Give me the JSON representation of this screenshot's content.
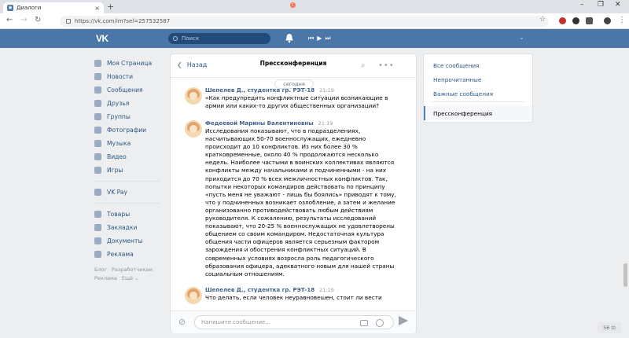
{
  "browser": {
    "tab_title": "Диалоги",
    "tab_favicon": "vk",
    "new_tab": "+",
    "url": "https://vk.com/im?sel=257532587",
    "win_min": "–",
    "win_max": "❐",
    "win_close": "✕"
  },
  "header": {
    "logo": "VK",
    "search_placeholder": "Поиск",
    "notifications_count": "1",
    "player_controls": "⏮▶⏭",
    "menu_chevron": "⌄"
  },
  "left_nav": {
    "group1": [
      "Моя Страница",
      "Новости",
      "Сообщения",
      "Друзья",
      "Группы",
      "Фотографии",
      "Музыка",
      "Видео",
      "Игры"
    ],
    "group2": [
      "VK Pay"
    ],
    "group3": [
      "Товары",
      "Закладки",
      "Документы",
      "Реклама"
    ],
    "footer": [
      "Блог",
      "Разработчикам",
      "Реклама",
      "Ещё ⌄"
    ]
  },
  "chat": {
    "back_label": "Назад",
    "title": "Прессконференция",
    "date_divider": "сегодня",
    "messages": [
      {
        "author": "Шепелев Д., студентка гр. РЭТ-18",
        "time": "21:19",
        "text": "«Как предупредить конфликтные ситуации возникающие в армии или каких-то других общественных организации?"
      },
      {
        "author": "Федеевой Марины Валентиновны",
        "time": "21:19",
        "text": "Исследования показывают, что в подразделениях, насчитывающих 50-70 военнослужащих, ежедневно происходит до 10 конфликтов. Из них более 30 % кратковременные, около 40 % продолжаются несколько недель. Наиболее частыми в воинских коллективах являются конфликты между начальниками и подчиненными - на них приходится до 70 % всех межличностных конфликтов. Так, попытки некоторых командиров действовать по принципу «пусть меня не уважают - лишь бы боялись» приводят к тому, что у подчиненных возникает озлобление, а затем и желание организованно противодействовать любым действиям руководителя. К сожалению, результаты исследований показывают, что 20-25 % военнослужащих не удовлетворены общением со своим командиром. Недостаточная культура общения части офицеров является серьезным фактором зарождения и обострения конфликтных ситуаций. В современных условиях возросла роль педагогического образования офицера, адекватного новым для нашей страны социальным отношениям."
      },
      {
        "author": "Шепелев Д., студентка гр. РЭТ-18",
        "time": "21:19",
        "text": "Что делать, если человек неуравновешен, стоит ли вести"
      }
    ],
    "composer_placeholder": "Напишите сообщение..."
  },
  "right_nav": {
    "items": [
      "Все сообщения",
      "Непрочитанные",
      "Важные сообщения"
    ],
    "active": "Прессконференция"
  },
  "corner_badge": "56 ⊡",
  "colors": {
    "brand": "#4a76a8",
    "link": "#2a5885",
    "author": "#42648b"
  }
}
